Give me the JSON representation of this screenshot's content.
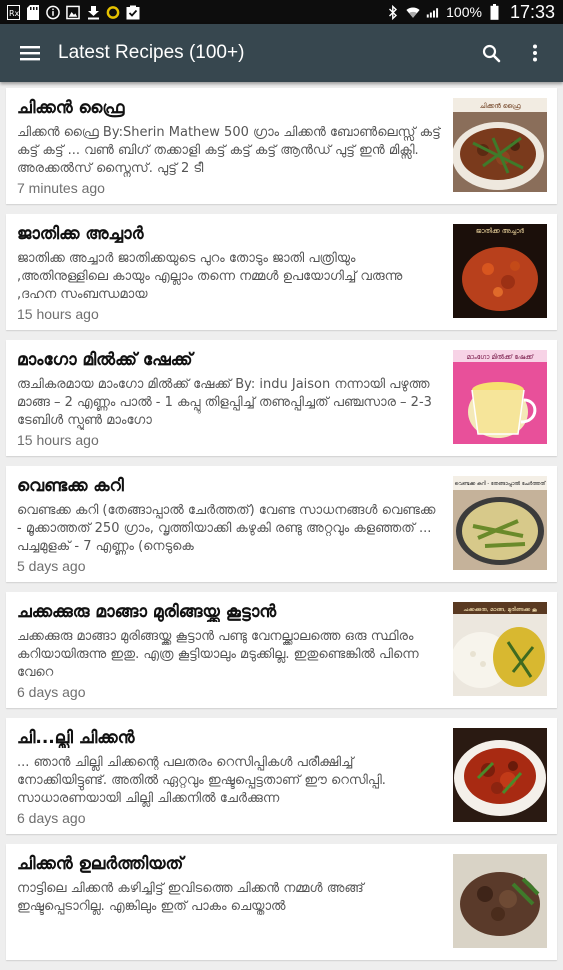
{
  "status_bar": {
    "battery_percent": "100%",
    "time": "17:33"
  },
  "app_bar": {
    "title": "Latest Recipes (100+)",
    "icons": [
      "menu-icon",
      "search-icon",
      "more-vert-icon"
    ]
  },
  "recipes": [
    {
      "title": "ചിക്കൻ ഫ്രൈ",
      "snippet": "ചിക്കൻ ഫ്രൈ By:Sherin Mathew 500 ഗ്രാം ചിക്കൻ ബോൺലെസ്സ് കട്ട് കട്ട് കട്ട് ... വൺ ബിഗ് തക്കാളി കട്ട് കട്ട് കട്ട് ആൻഡ് പുട്ട് ഇൻ മിക്സി. അരക്കൽസ് സ്നൈസ്. പുട്ട് 2 ടീ",
      "time": "7 minutes ago",
      "thumb_label": "ചിക്കൻ ഫ്രൈ"
    },
    {
      "title": "ജാതിക്ക അച്ചാർ",
      "snippet": "ജാതിക്ക അച്ചാർ ജാതിക്കയുടെ പുറം തോടും ജാതി പത്രിയും ,അതിനുള്ളിലെ കായും എല്ലാം തന്നെ നമ്മൾ ഉപയോഗിച്ച് വരുന്നു ,ദഹന സംബന്ധമായ",
      "time": "15 hours ago",
      "thumb_label": "ജാതിക്ക അച്ചാർ"
    },
    {
      "title": "മാംഗോ മിൽക്ക് ഷേക്ക്",
      "snippet": "രുചികരമായ മാംഗോ മിൽക്ക് ഷേക്ക് By: indu Jaison നന്നായി പഴുത്ത മാങ്ങ – 2 എണ്ണം പാൽ - 1 കപ്പു തിളപ്പിച്ച് തണുപ്പിച്ചത് പഞ്ചസാര – 2-3 ടേബിൾ സ്പൂൺ മാംഗോ",
      "time": "15 hours ago",
      "thumb_label": "മാംഗോ മിൽക്ക് ഷേക്ക്"
    },
    {
      "title": "വെണ്ടക്ക കറി",
      "snippet": "വെണ്ടക്ക കറി (തേങ്ങാപ്പാൽ ചേർത്തത്) വേണ്ട സാധനങ്ങൾ വെണ്ടക്ക - മൂക്കാത്തത് 250 ഗ്രാം, വൃത്തിയാക്കി കഴുകി രണ്ടു അറ്റവും കളഞ്ഞത് ... പച്ചമുളക് - 7 എണ്ണം (നെടുകെ",
      "time": "5 days ago",
      "thumb_label": "വെണ്ടക്ക കറി - തേങ്ങാപ്പാൽ ചേർത്തത്"
    },
    {
      "title": "ചക്കക്കുരു മാങ്ങാ മുരിങ്ങയ്ക്ക കൂട്ടാൻ",
      "snippet": "ചക്കക്കുരു മാങ്ങാ മുരിങ്ങയ്ക്ക കൂട്ടാൻ പണ്ടു വേനല്ക്കാലത്തെ ഒരു സ്ഥിരം കറിയായിരുന്നു ഇതു. എത്ര കൂട്ടിയാലും മടുക്കില്ല. ഇതുണ്ടെങ്കിൽ പിന്നെ വേറെ",
      "time": "6 days ago",
      "thumb_label": "ചക്കക്കുരു, മാങ്ങ, മുരിങ്ങക്ക കൂ"
    },
    {
      "title": "ചി...ല്ലി ചിക്കൻ",
      "snippet": "... ഞാൻ ചില്ലി ചിക്കന്റെ പലതരം റെസിപ്പികൾ പരീക്ഷിച്ച് നോക്കിയിട്ടുണ്ട്. അതിൽ ഏറ്റവും ഇഷ്ടപ്പെട്ടതാണ് ഈ റെസിപ്പി. സാധാരണയായി ചില്ലി ചിക്കനിൽ ചേർക്കുന്ന",
      "time": "6 days ago",
      "thumb_label": ""
    },
    {
      "title": "ചിക്കൻ ഉലർത്തിയത്",
      "snippet": "നാട്ടിലെ ചിക്കൻ കഴിച്ചിട്ട് ഇവിടത്തെ ചിക്കൻ നമ്മൾ അങ്ങ് ഇഷ്ടപ്പെടാറില്ല. എങ്കിലും ഇത് പാകം ചെയ്താൽ",
      "time": "",
      "thumb_label": ""
    }
  ],
  "colors": {
    "app_bar": "#37474f",
    "status_bar": "#0d0d0d",
    "background": "#eeeeee"
  }
}
